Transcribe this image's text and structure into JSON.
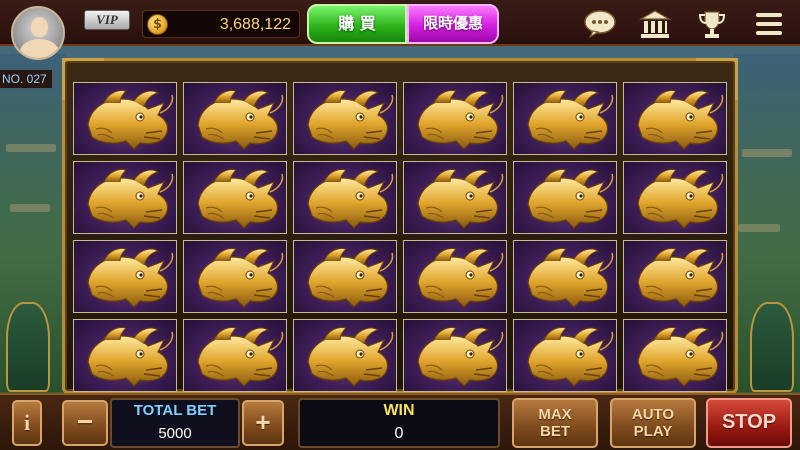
{
  "header": {
    "vip_label": "VIP",
    "balance": "3,688,122",
    "buy_label": "購 買",
    "promo_label": "限時優惠",
    "icons": [
      "chat-icon",
      "bank-icon",
      "trophy-icon",
      "menu-icon"
    ]
  },
  "machine": {
    "number_label": "NO. 027"
  },
  "reels": {
    "columns": 6,
    "rows": 4,
    "symbol": "golden-dragon"
  },
  "footer": {
    "info_label": "i",
    "minus_label": "−",
    "plus_label": "+",
    "total_bet_label": "TOTAL BET",
    "total_bet_value": "5000",
    "win_label": "WIN",
    "win_value": "0",
    "max_bet_line1": "MAX",
    "max_bet_line2": "BET",
    "auto_play_line1": "AUTO",
    "auto_play_line2": "PLAY",
    "stop_label": "STOP"
  },
  "colors": {
    "accent_gold": "#b58d3a",
    "buy_green": "#2db51a",
    "promo_magenta": "#d41fe1",
    "stop_red": "#9a1a12",
    "bet_label_blue": "#7fd0ff",
    "win_label_yellow": "#f7e35c"
  }
}
